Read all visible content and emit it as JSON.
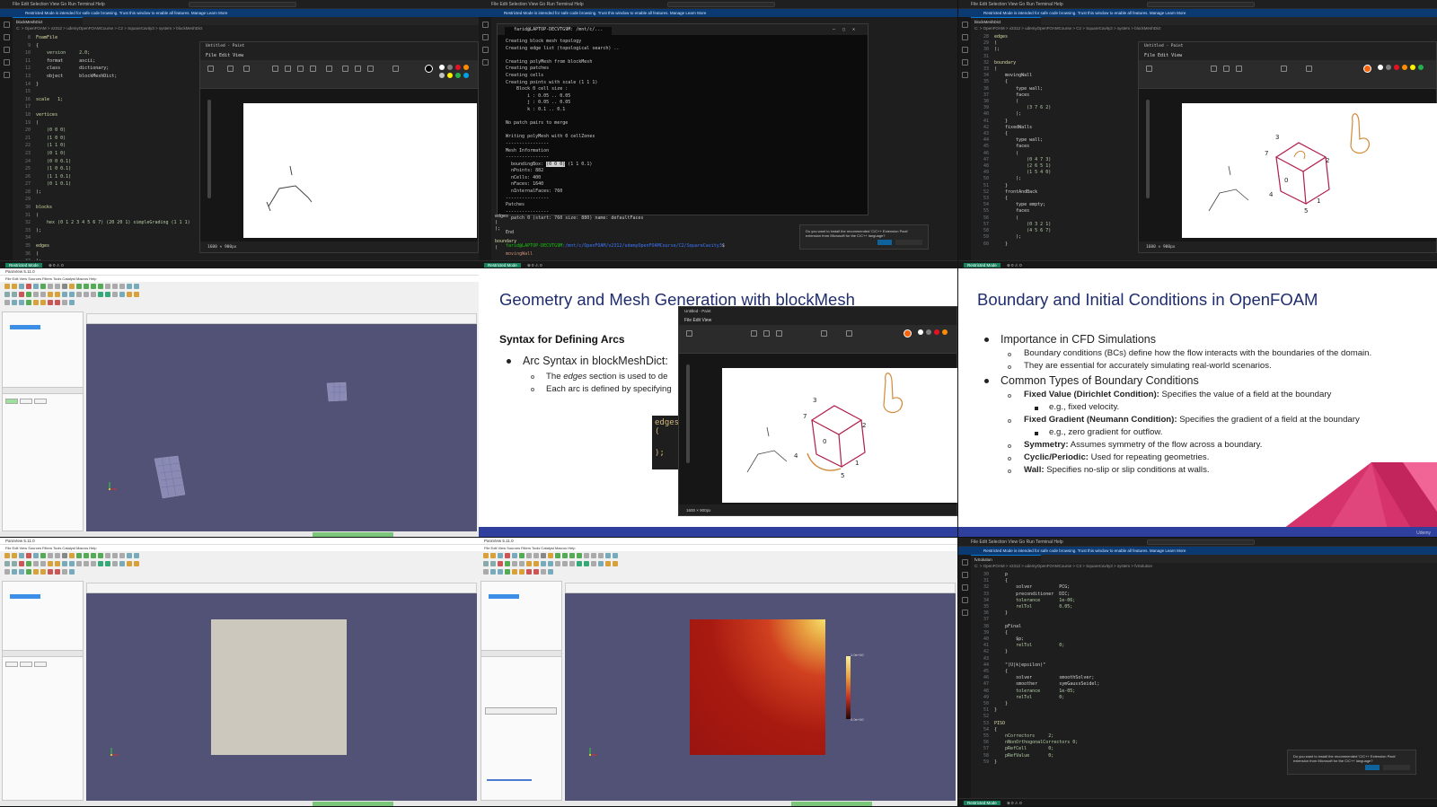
{
  "vscode": {
    "menu": "File  Edit  Selection  View  Go  Run  Terminal  Help",
    "search": "OF2312",
    "banner": "Restricted Mode is intended for safe code browsing. Trust this window to enable all features.   Manage   Learn More",
    "tab1": "blockMeshDict",
    "tab2": "blockMeshDict",
    "tab3": "fvSolution",
    "crumb": "C: > OpenFOAM > v2312 > udemyOpenFOAMCourse > C2 > SquareCavity3 > system > blockMeshDict",
    "crumb3": "C: > OpenFOAM > v2312 > udemyOpenFOAMCourse > C3 > SquareCavity3 > system > fvSolution",
    "status_remote": "Restricted Mode",
    "status_text": "⊗ 0 ⚠ 0",
    "status_right": "Ln 31, Col 1   Spaces: 4   UTF-8   LF   Plain Text",
    "toast": "Do you want to install the recommended 'C/C++ Extension Pack' extension from Microsoft for the C/C++ language?",
    "toast_install": "Install",
    "toast_show": "Show Recommendations"
  },
  "paint": {
    "title": "Untitled - Paint",
    "menu": "File   Edit   View",
    "status1": "1600 × 900px",
    "status2": "100%"
  },
  "terminal": {
    "tab": "farid@LAPTOP-DECVTG9M: /mnt/c/...",
    "lines": [
      "Creating block mesh topology",
      "Creating edge list (topological search) ..",
      "",
      "Creating polyMesh from blockMesh",
      "Creating patches",
      "Creating cells",
      "Creating points with scale (1 1 1)",
      "    Block 0 cell size :",
      "        i : 0.05 .. 0.05",
      "        j : 0.05 .. 0.05",
      "        k : 0.1 .. 0.1",
      "",
      "No patch pairs to merge",
      "",
      "Writing polyMesh with 0 cellZones",
      "----------------",
      "Mesh Information",
      "----------------"
    ],
    "bbox_label": "  boundingBox: ",
    "bbox_hl": "(0 0 0)",
    "bbox_rest": " (1 1 0.1)",
    "lines2": [
      "  nPoints: 882",
      "  nCells: 400",
      "  nFaces: 1640",
      "  nInternalFaces: 760",
      "----------------",
      "Patches",
      "----------------",
      "  patch 0 (start: 760 size: 880) name: defaultFaces",
      "",
      "End",
      ""
    ],
    "prompt_user": "farid@LAPTOP-DECVTG9M",
    "prompt_path": ":/mnt/c/OpenFOAM/v2312/udemyOpenFOAMCourse/C2/SquareCavity3",
    "prompt_end": "$"
  },
  "paraview": {
    "title": "ParaView 5.11.0",
    "menu": "File  Edit  View  Sources  Filters  Tools  Catalyst  Macros  Help",
    "pipeline": "Pipeline Browser",
    "builtin": "builtin:",
    "source": "cavity.foam",
    "tab_properties": "Properties",
    "tab_info": "Information",
    "btn_apply": "Apply",
    "btn_reset": "Reset",
    "btn_delete": "Delete",
    "search": "Search ... (use Esc to clear text)",
    "properties_section": "Properties (cavity.foam)",
    "refresh": "Refresh",
    "mesh_regions": "Mesh Regions",
    "internal_mesh": "internalMesh",
    "cell_arrays": "Cell Arrays",
    "display": "Display (UnstructuredGridRepresentation)",
    "representation": "Surface",
    "coloring": "Coloring",
    "color_by": "U",
    "render_view": "RenderView1",
    "legend_max": "1.0e+00",
    "legend_min": "0.0e+00",
    "legend_title": "U Magnitude",
    "status_mem": "DESKTOP-... 4.2 GiB/15.8 GiB 26.6%"
  },
  "slide1": {
    "title": "Geometry and Mesh Generation with blockMesh",
    "subtitle": "Syntax for Defining Arcs",
    "bullet": "Arc Syntax in blockMeshDict:",
    "sub1_pre": "The ",
    "sub1_em": "edges",
    "sub1_post": " section is used to de",
    "sub2": "Each arc is defined by specifying",
    "code_head": "edges",
    "code_open": "(",
    "code_close": ");"
  },
  "slide2": {
    "title": "Boundary and Initial Conditions in OpenFOAM",
    "b1": "Importance in CFD Simulations",
    "b1s1": "Boundary conditions (BCs) define how the flow interacts with the boundaries of the domain.",
    "b1s2": "They are essential for accurately simulating real-world scenarios.",
    "b2": "Common Types of Boundary Conditions",
    "fv_label": "Fixed Value (Dirichlet Condition):",
    "fv_text": " Specifies the value of a field at the boundary",
    "fv_eg": "e.g., fixed velocity.",
    "fg_label": "Fixed Gradient (Neumann Condition):",
    "fg_text": " Specifies the gradient of a field at the boundary",
    "fg_eg": "e.g., zero gradient for outflow.",
    "sym_label": "Symmetry:",
    "sym_text": " Assumes symmetry of the flow across a boundary.",
    "cyc_label": "Cyclic/Periodic:",
    "cyc_text": " Used for repeating geometries.",
    "wall_label": "Wall:",
    "wall_text": " Specifies no-slip or slip conditions at walls.",
    "brand": "Udemy"
  },
  "code1": [
    [
      "",
      "FoamFile"
    ],
    [
      "",
      "{"
    ],
    [
      "",
      "    version     2.0;"
    ],
    [
      "",
      "    format      ascii;"
    ],
    [
      "",
      "    class       dictionary;"
    ],
    [
      "",
      "    object      blockMeshDict;"
    ],
    [
      "",
      "}"
    ],
    [
      "",
      ""
    ],
    [
      "",
      "scale   1;"
    ],
    [
      "",
      ""
    ],
    [
      "",
      "vertices"
    ],
    [
      "",
      "("
    ],
    [
      "",
      "    (0 0 0)"
    ],
    [
      "",
      "    (1 0 0)"
    ],
    [
      "",
      "    (1 1 0)"
    ],
    [
      "",
      "    (0 1 0)"
    ],
    [
      "",
      "    (0 0 0.1)"
    ],
    [
      "",
      "    (1 0 0.1)"
    ],
    [
      "",
      "    (1 1 0.1)"
    ],
    [
      "",
      "    (0 1 0.1)"
    ],
    [
      "",
      ");"
    ],
    [
      "",
      ""
    ],
    [
      "",
      "blocks"
    ],
    [
      "",
      "("
    ],
    [
      "",
      "    hex (0 1 2 3 4 5 6 7) (20 20 1) simpleGrading (1 1 1)"
    ],
    [
      "",
      ");"
    ],
    [
      "",
      ""
    ],
    [
      "",
      "edges"
    ],
    [
      "",
      "("
    ],
    [
      "",
      ");"
    ],
    [
      "",
      ""
    ],
    [
      "",
      "boundary"
    ],
    [
      "",
      "("
    ],
    [
      "",
      "    movingWall"
    ]
  ],
  "code3": [
    "edges",
    "(",
    ");",
    "",
    "boundary",
    "(",
    "    movingWall",
    "    {",
    "        type wall;",
    "        faces",
    "        (",
    "            (3 7 6 2)",
    "        );",
    "    }",
    "    fixedWalls",
    "    {",
    "        type wall;",
    "        faces",
    "        (",
    "            (0 4 7 3)",
    "            (2 6 5 1)",
    "            (1 5 4 0)",
    "        );",
    "    }",
    "    frontAndBack",
    "    {",
    "        type empty;",
    "        faces",
    "        (",
    "            (0 3 2 1)",
    "            (4 5 6 7)",
    "        );",
    "    }"
  ],
  "code9": [
    "    p",
    "    {",
    "        solver          PCG;",
    "        preconditioner  DIC;",
    "        tolerance       1e-06;",
    "        relTol          0.05;",
    "    }",
    "",
    "    pFinal",
    "    {",
    "        $p;",
    "        relTol          0;",
    "    }",
    "",
    "    \"(U|k|epsilon)\"",
    "    {",
    "        solver          smoothSolver;",
    "        smoother        symGaussSeidel;",
    "        tolerance       1e-05;",
    "        relTol          0;",
    "    }",
    "}",
    "",
    "PISO",
    "{",
    "    nCorrectors     2;",
    "    nNonOrthogonalCorrectors 0;",
    "    pRefCell        0;",
    "    pRefValue       0;",
    "}"
  ],
  "colors": {
    "slide_title": "#1f2d6e",
    "accent_pink": "#e0457b",
    "paraview_bg": "#525277",
    "terminal_prompt": "#16c60c"
  }
}
